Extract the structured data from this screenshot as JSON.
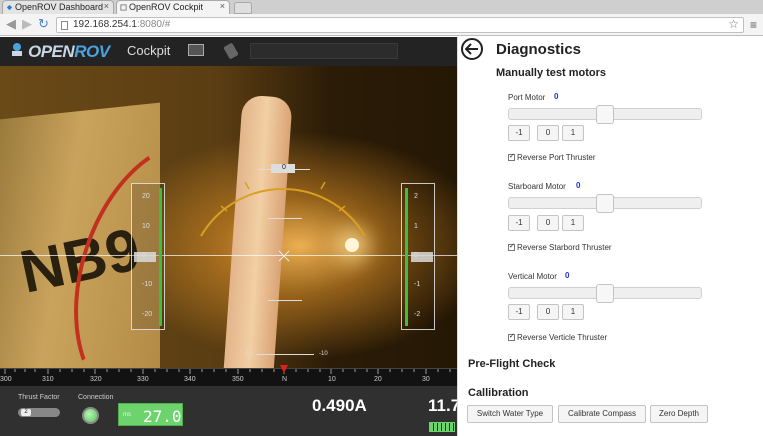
{
  "browser": {
    "tabs": [
      {
        "label": "OpenROV Dashboard"
      },
      {
        "label": "OpenROV Cockpit"
      }
    ],
    "url_host": "192.168.254.1",
    "url_rest": ":8080/#"
  },
  "cockpit": {
    "logo_open": "OPEN",
    "logo_rov": "ROV",
    "title": "Cockpit",
    "left_ladder_ticks": [
      "20",
      "10",
      "0",
      "-10",
      "-20"
    ],
    "right_ladder_ticks": [
      "2",
      "1",
      "0",
      "-1",
      "-2"
    ],
    "heading_top": "0",
    "pitch_label_left": "-10",
    "pitch_label_right": "-10",
    "compass_labels": [
      "300",
      "310",
      "320",
      "330",
      "340",
      "350",
      "N",
      "10",
      "20",
      "30"
    ],
    "thrust_factor_label": "Thrust Factor",
    "thrust_factor_value": "2",
    "connection_label": "Connection",
    "depth_unit": "ms",
    "depth_value": "27.0",
    "current": "0.490A",
    "voltage": "11.7",
    "cardboard_text": "NB9",
    "colors": {
      "accent": "#6dd36d",
      "heading_marker": "#e02020",
      "arc": "#d8a020"
    }
  },
  "diagnostics": {
    "title": "Diagnostics",
    "subtitle": "Manually test motors",
    "motors": [
      {
        "label": "Port Motor",
        "value": "0",
        "buttons": [
          "-1",
          "0",
          "1"
        ],
        "reverse_label": "Reverse Port Thruster"
      },
      {
        "label": "Starboard Motor",
        "value": "0",
        "buttons": [
          "-1",
          "0",
          "1"
        ],
        "reverse_label": "Reverse Starbord Thruster"
      },
      {
        "label": "Vertical Motor",
        "value": "0",
        "buttons": [
          "-1",
          "0",
          "1"
        ],
        "reverse_label": "Reverse Verticle Thruster"
      }
    ],
    "preflight_title": "Pre-Flight Check",
    "calibration_title": "Callibration",
    "calibration_buttons": [
      "Switch Water Type",
      "Calibrate Compass",
      "Zero Depth"
    ]
  }
}
